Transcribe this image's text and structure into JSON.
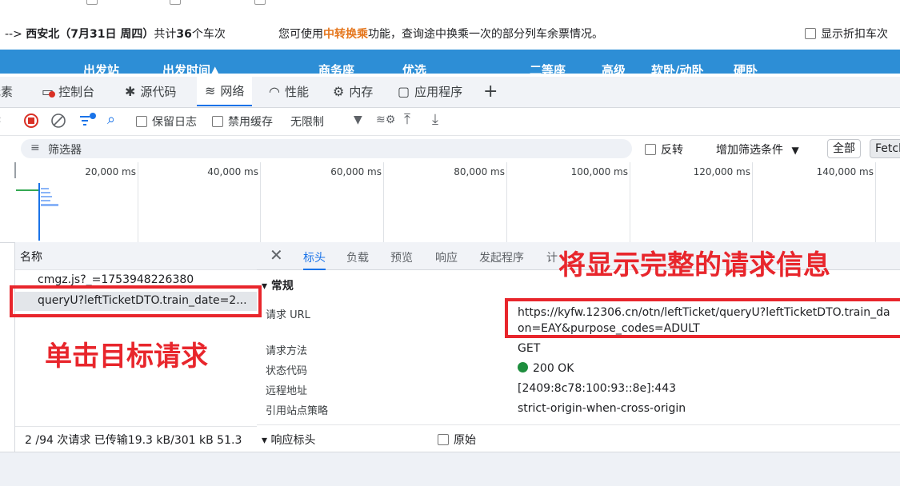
{
  "site": {
    "route_prefix": "--> ",
    "route_station": "西安北（7月31日  周四）",
    "route_total": "共计",
    "route_count": "36",
    "route_suffix": "个车次",
    "hint_pre": "您可使用",
    "hint_highlight": "中转换乘",
    "hint_post": "功能，查询途中换乘一次的部分列车余票情况。",
    "discount_label": "显示折扣车次",
    "table_headers": [
      "出发站",
      "出发时间▲",
      "商务座",
      "优选",
      "二等座",
      "高级",
      "软卧/动卧",
      "硬卧"
    ]
  },
  "devtools": {
    "tabs": [
      {
        "label": "元素",
        "icon": ""
      },
      {
        "label": "控制台",
        "icon": "▭"
      },
      {
        "label": "源代码",
        "icon": "✱"
      },
      {
        "label": "网络",
        "icon": "≋"
      },
      {
        "label": "性能",
        "icon": "◠"
      },
      {
        "label": "内存",
        "icon": "⚙"
      },
      {
        "label": "应用程序",
        "icon": "▢"
      }
    ],
    "add_tab": "+",
    "toolbar": {
      "preserve_log": "保留日志",
      "disable_cache": "禁用缓存",
      "throttle": "无限制"
    },
    "filter": {
      "placeholder": "筛选器",
      "invert": "反转",
      "more_filters": "增加筛选条件",
      "all": "全部",
      "fetch": "Fetch"
    },
    "timeline_ticks": [
      "20,000 ms",
      "40,000 ms",
      "60,000 ms",
      "80,000 ms",
      "100,000 ms",
      "120,000 ms",
      "140,000 ms"
    ],
    "requests": {
      "column_name": "名称",
      "items": [
        "cmgz.js?_=1753948226380",
        "queryU?leftTicketDTO.train_date=2..."
      ],
      "footer": "2 /94 次请求   已传输19.3 kB/301 kB   51.3"
    },
    "detail_tabs": [
      "标头",
      "负载",
      "预览",
      "响应",
      "发起程序",
      "计"
    ],
    "general": {
      "section": "▾ 常规",
      "request_url_label": "请求 URL",
      "request_url_line1": "https://kyfw.12306.cn/otn/leftTicket/queryU?leftTicketDTO.train_da",
      "request_url_line2": "on=EAY&purpose_codes=ADULT",
      "method_label": "请求方法",
      "method": "GET",
      "status_label": "状态代码",
      "status": "200 OK",
      "remote_label": "远程地址",
      "remote": "[2409:8c78:100:93::8e]:443",
      "referrer_label": "引用站点策略",
      "referrer": "strict-origin-when-cross-origin"
    },
    "response_headers": {
      "section": "▾ 响应标头",
      "raw": "原始"
    }
  },
  "annotations": {
    "click_target": "单击目标请求",
    "full_info": "将显示完整的请求信息"
  },
  "colors": {
    "accent": "#1a73e8",
    "header_blue": "#2d8ed6",
    "annotation_red": "#e8262c",
    "status_green": "#1e8e3e",
    "highlight_orange": "#e5771e"
  }
}
